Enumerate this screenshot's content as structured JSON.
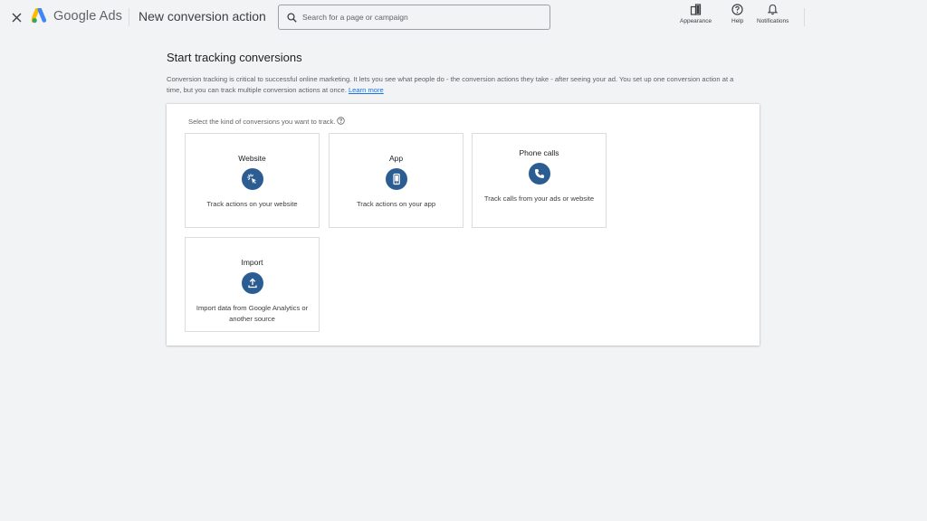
{
  "header": {
    "brand": "Google Ads",
    "title": "New conversion action",
    "search_placeholder": "Search for a page or campaign",
    "tools": [
      {
        "label": "Appearance",
        "icon": "appearance-icon"
      },
      {
        "label": "Help",
        "icon": "help-icon"
      },
      {
        "label": "Notifications",
        "icon": "bell-icon"
      }
    ]
  },
  "main": {
    "heading": "Start tracking conversions",
    "intro": "Conversion tracking is critical to successful online marketing. It lets you see what people do - the conversion actions they take - after seeing your ad. You set up one conversion action at a time, but you can track multiple conversion actions at once.",
    "learn_more": "Learn more",
    "prompt": "Select the kind of conversions you want to track.",
    "cards": [
      {
        "title": "Website",
        "desc": "Track actions on your website",
        "icon": "cursor-click-icon"
      },
      {
        "title": "App",
        "desc": "Track actions on your app",
        "icon": "phone-app-icon"
      },
      {
        "title": "Phone calls",
        "desc": "Track calls from your ads or website",
        "icon": "phone-call-icon"
      },
      {
        "title": "Import",
        "desc": "Import data from Google Analytics or another source",
        "icon": "upload-icon"
      }
    ]
  },
  "colors": {
    "background": "#f1f3f4",
    "accent": "#2b5d93",
    "link": "#1a73e8"
  }
}
